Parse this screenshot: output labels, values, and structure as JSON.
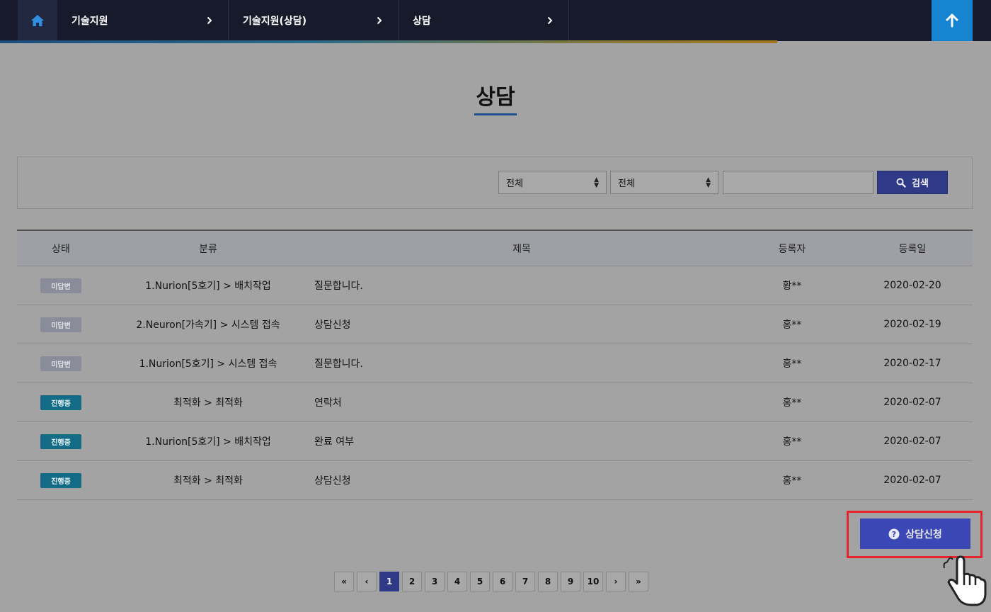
{
  "breadcrumb": {
    "items": [
      {
        "label": "기술지원"
      },
      {
        "label": "기술지원(상담)"
      },
      {
        "label": "상담"
      }
    ]
  },
  "page": {
    "title": "상담"
  },
  "search": {
    "select1": "전체",
    "select2": "전체",
    "query": "",
    "button_label": "검색"
  },
  "table": {
    "headers": [
      "상태",
      "분류",
      "제목",
      "등록자",
      "등록일"
    ],
    "rows": [
      {
        "status": "미답변",
        "status_type": "wait",
        "category": "1.Nurion[5호기] > 배치작업",
        "title": "질문합니다.",
        "author": "황**",
        "date": "2020-02-20"
      },
      {
        "status": "미답변",
        "status_type": "wait",
        "category": "2.Neuron[가속기] > 시스템 접속",
        "title": "상담신청",
        "author": "홍**",
        "date": "2020-02-19"
      },
      {
        "status": "미답변",
        "status_type": "wait",
        "category": "1.Nurion[5호기] > 시스템 접속",
        "title": "질문합니다.",
        "author": "홍**",
        "date": "2020-02-17"
      },
      {
        "status": "진행중",
        "status_type": "prog",
        "category": "최적화 > 최적화",
        "title": "연락처",
        "author": "홍**",
        "date": "2020-02-07"
      },
      {
        "status": "진행중",
        "status_type": "prog",
        "category": "1.Nurion[5호기] > 배치작업",
        "title": "완료 여부",
        "author": "홍**",
        "date": "2020-02-07"
      },
      {
        "status": "진행중",
        "status_type": "prog",
        "category": "최적화 > 최적화",
        "title": "상담신청",
        "author": "홍**",
        "date": "2020-02-07"
      }
    ]
  },
  "apply_button": {
    "label": "상담신청"
  },
  "pagination": {
    "first": "«",
    "prev": "‹",
    "pages": [
      "1",
      "2",
      "3",
      "4",
      "5",
      "6",
      "7",
      "8",
      "9",
      "10"
    ],
    "current": "1",
    "next": "›",
    "last": "»"
  },
  "colors": {
    "topbar": "#171a2a",
    "up_button": "#1784d2",
    "primary_button": "#2e3a86",
    "highlight": "#e5232b"
  }
}
